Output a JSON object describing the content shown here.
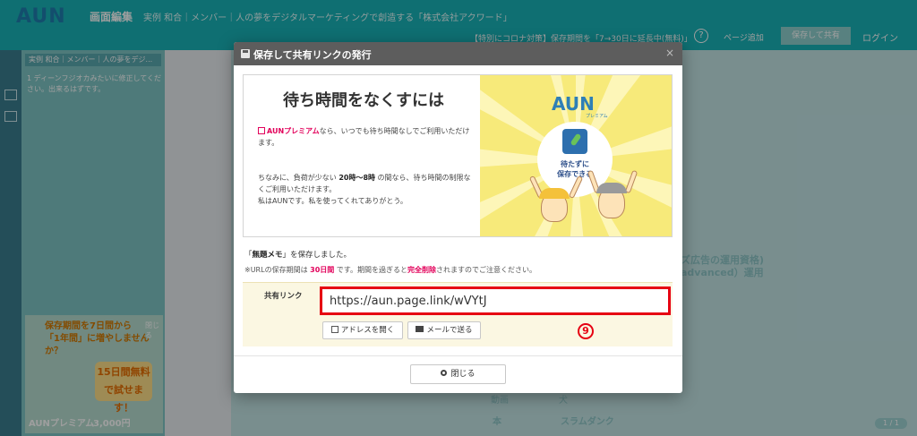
{
  "app": {
    "logo": "AUN",
    "title": "画面編集",
    "subtitle": "実例 和合｜メンバー｜人の夢をデジタルマーケティングで創造する「株式会社アクワード」",
    "notice": "【特別にコロナ対策】保存期間を「7→30日に延長中(無料)」",
    "help_icon": "?",
    "page_add": "ページ追加",
    "save_button": "保存して共有",
    "login": "ログイン"
  },
  "left_panel": {
    "header": "実例 和合｜メンバー｜人の夢をデジ...",
    "item_number": "1",
    "item_text": "ディーンフジオカみたいに修正してください。出来るはずです。"
  },
  "ad": {
    "text1": "保存期間を7日間から",
    "text2": "「1年間」に増やしませんか？",
    "badge_line1": "15日間無料",
    "badge_line2": "で試せます！",
    "brand": "AUNプレミアム",
    "price": "3,000円",
    "close": "閉じる"
  },
  "background": {
    "right1": "ズ広告の運用資格)",
    "right2": "advanced）運用",
    "table_r1c1": "動画",
    "table_r1c2": "犬",
    "table_r2c1": "本",
    "table_r2c2": "スラムダンク",
    "page_indicator": "1 / 1"
  },
  "modal": {
    "title": "保存して共有リンクの発行",
    "close_icon": "×",
    "promo": {
      "title": "待ち時間をなくすには",
      "premium_link": "AUNプレミアム",
      "p1_rest": "なら、いつでも待ち時間なしでご利用いただけます。",
      "p2_a": "ちなみに、負荷が少ない ",
      "p2_time": "20時～8時",
      "p2_b": " の間なら、待ち時間の制限なくご利用いただけます。",
      "p2_c": "私はAUNです。私を使ってくれてありがとう。",
      "image_logo": "AUN",
      "image_logo_sub": "プレミアム",
      "image_circle_l1": "待たずに",
      "image_circle_l2": "保存できる"
    },
    "memo_prefix": "「",
    "memo_name": "無題メモ",
    "memo_suffix": "」を保存しました。",
    "note_a": "※URLの保存期間は ",
    "note_days": "30日間",
    "note_b": " です。期間を過ぎると",
    "note_delete": "完全削除",
    "note_c": "されますのでご注意ください。",
    "share_label": "共有リンク",
    "share_url": "https://aun.page.link/wVYtJ",
    "open_button": "アドレスを開く",
    "mail_button": "メールで送る",
    "annotation": "9",
    "close_button": "閉じる"
  },
  "colors": {
    "accent_teal": "#19b3b8",
    "highlight_red": "#e60012",
    "premium_pink": "#e2005a"
  }
}
